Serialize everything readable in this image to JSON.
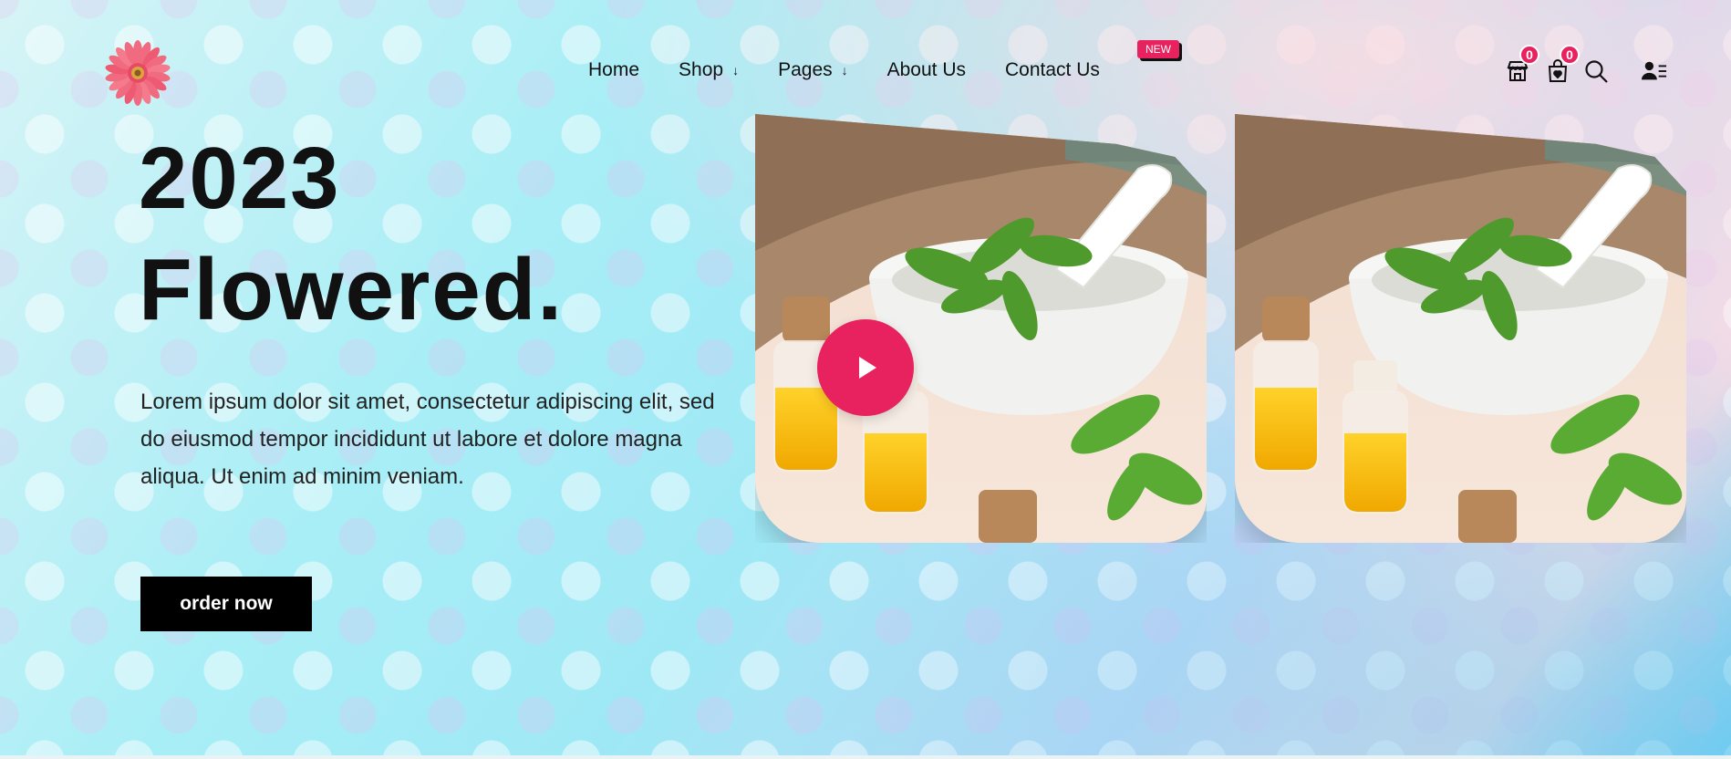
{
  "header": {
    "logo": "gerbera-flower-logo",
    "nav": [
      {
        "label": "Home",
        "has_dropdown": false
      },
      {
        "label": "Shop",
        "has_dropdown": true
      },
      {
        "label": "Pages",
        "has_dropdown": true
      },
      {
        "label": "About Us",
        "has_dropdown": false
      },
      {
        "label": "Contact Us",
        "has_dropdown": false
      }
    ],
    "new_badge": "NEW",
    "icons": {
      "store": {
        "name": "store-icon",
        "count": "0"
      },
      "bag": {
        "name": "shopping-bag-icon",
        "count": "0"
      },
      "search": {
        "name": "search-icon"
      },
      "user": {
        "name": "user-menu-icon"
      }
    }
  },
  "hero": {
    "title_line1": "2023",
    "title_line2": "Flowered.",
    "text": "Lorem ipsum dolor sit amet, consectetur adipiscing elit, sed do eiusmod tempor incididunt ut labore et dolore magna aliqua. Ut enim ad minim veniam.",
    "button": "order now"
  },
  "media": {
    "image_subject": "mortar-with-basil-and-oil-bottles",
    "play_icon": "play-icon"
  },
  "colors": {
    "accent": "#e8215f",
    "text": "#111111",
    "button_bg": "#000000"
  }
}
